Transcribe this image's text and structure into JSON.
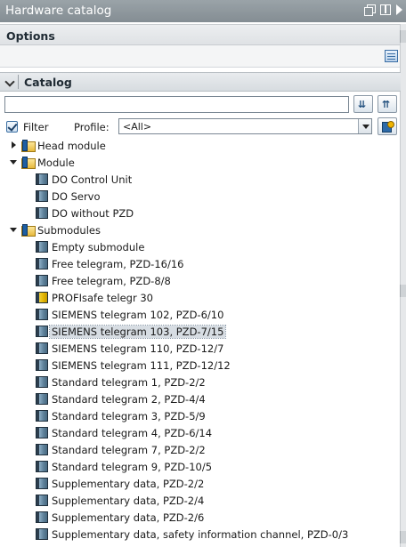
{
  "window": {
    "title": "Hardware catalog"
  },
  "options": {
    "label": "Options"
  },
  "catalog": {
    "label": "Catalog",
    "search_value": "",
    "filter_label": "Filter",
    "filter_checked": true,
    "profile_label": "Profile:",
    "profile_value": "<All>"
  },
  "tree": {
    "head_module": "Head module",
    "module": "Module",
    "module_items": [
      "DO Control Unit",
      "DO Servo",
      "DO without PZD"
    ],
    "submodules": "Submodules",
    "submodule_items": [
      "Empty submodule",
      "Free telegram, PZD-16/16",
      "Free telegram, PZD-8/8",
      "PROFIsafe telegr 30",
      "SIEMENS telegram 102, PZD-6/10",
      "SIEMENS telegram 103, PZD-7/15",
      "SIEMENS telegram 110, PZD-12/7",
      "SIEMENS telegram 111, PZD-12/12",
      "Standard telegram 1, PZD-2/2",
      "Standard telegram 2, PZD-4/4",
      "Standard telegram 3, PZD-5/9",
      "Standard telegram 4, PZD-6/14",
      "Standard telegram 7, PZD-2/2",
      "Standard telegram 9, PZD-10/5",
      "Supplementary data, PZD-2/2",
      "Supplementary data, PZD-2/4",
      "Supplementary data, PZD-2/6",
      "Supplementary data, safety information channel, PZD-0/3"
    ],
    "selected_item": "SIEMENS telegram 103, PZD-7/15"
  }
}
